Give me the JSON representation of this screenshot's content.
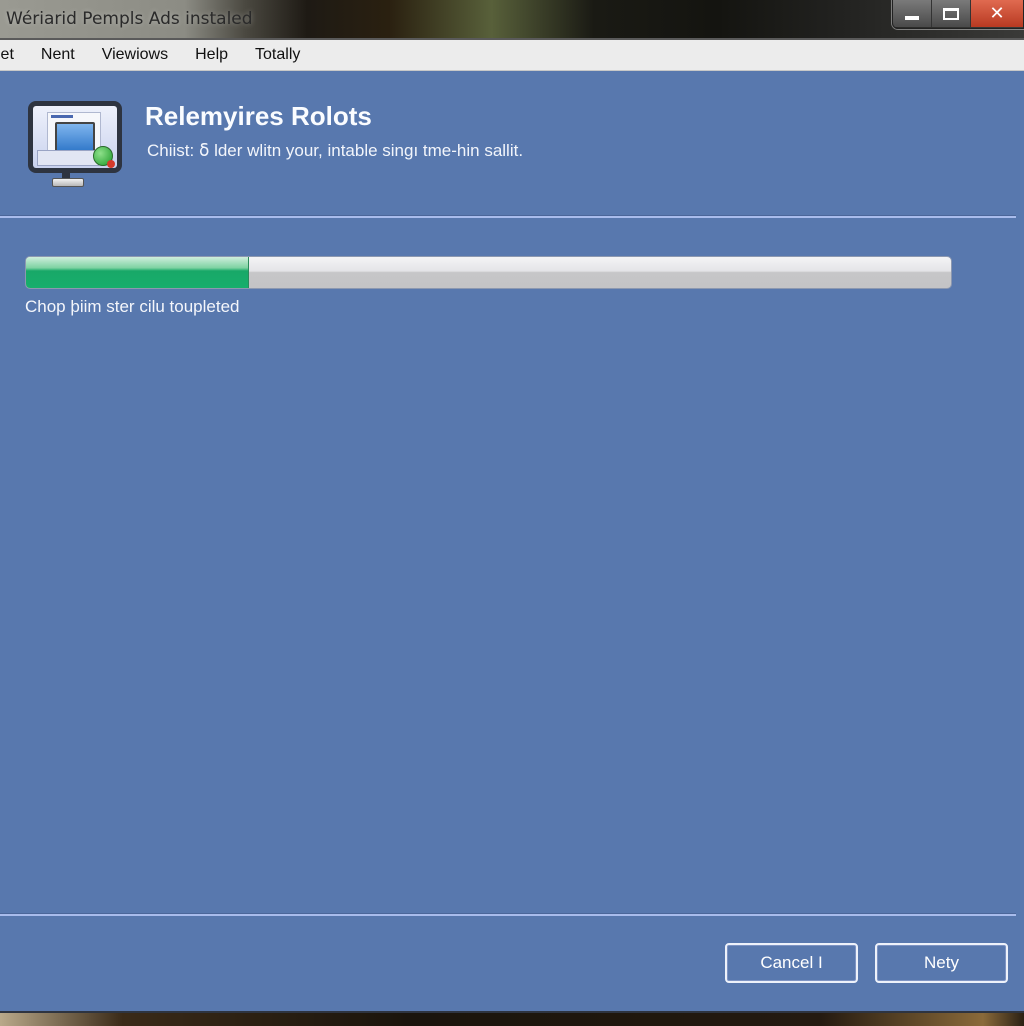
{
  "window": {
    "title": "Wériarid Pempls Ads instaled",
    "controls": {
      "minimize_icon": "minimize-icon",
      "maximize_icon": "maximize-icon",
      "close_icon": "close-icon",
      "close_glyph": "✕"
    }
  },
  "menubar": {
    "items": [
      {
        "label": "let"
      },
      {
        "label": "Nent"
      },
      {
        "label": "Viewiows"
      },
      {
        "label": "Help"
      },
      {
        "label": "Totally"
      }
    ]
  },
  "header": {
    "icon": "computer-install-icon",
    "title": "Relemyires Rolots",
    "subtitle": "Chiist: ẟ lder wlitn your,  intable singı tme-hin sallit."
  },
  "progress": {
    "value_percent": 24,
    "fill_color": "#17ae6c",
    "status_text": "Chop þiim ster cilu toupleted"
  },
  "buttons": {
    "cancel_label": "Cancel I",
    "next_label": "Nety"
  },
  "colors": {
    "background": "#5878ae",
    "menubar": "#ececec",
    "separator": "#a9bcec"
  }
}
